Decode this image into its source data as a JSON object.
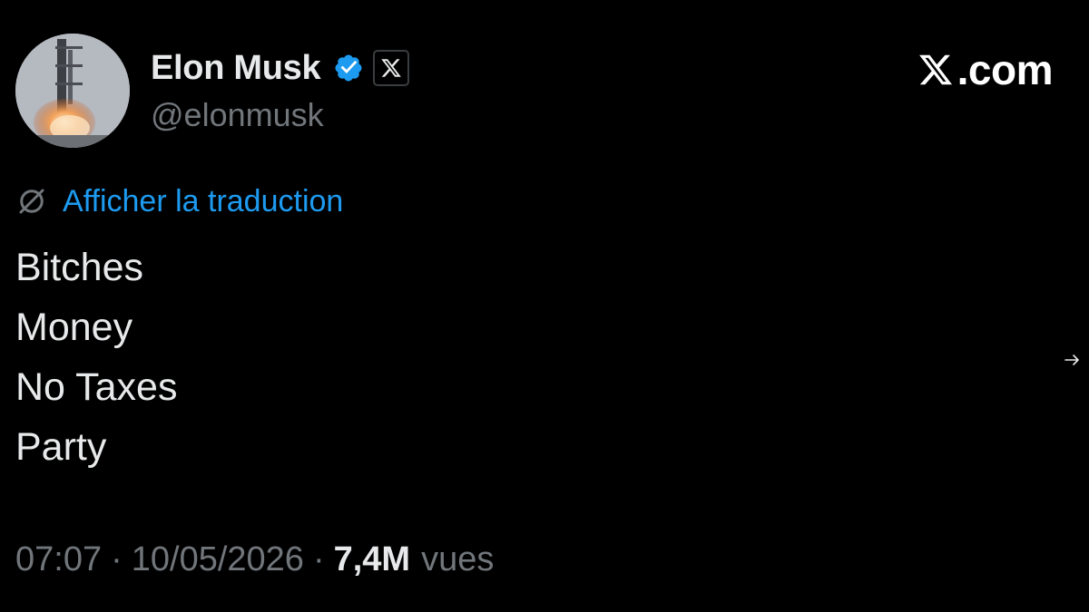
{
  "author": {
    "display_name": "Elon Musk",
    "handle": "@elonmusk",
    "avatar_icon": "rocket-launch-avatar",
    "verified_icon": "verified-badge-icon",
    "affiliation_icon": "x-logo-icon"
  },
  "brand": {
    "logo_icon": "x-logo-icon",
    "text": ".com"
  },
  "translate": {
    "icon": "globe-icon",
    "label": "Afficher la traduction"
  },
  "tweet": {
    "lines": [
      "Bitches",
      "Money",
      "No Taxes",
      "Party"
    ]
  },
  "meta": {
    "time": "07:07",
    "separator": "·",
    "date": "10/05/2026",
    "views_count": "7,4M",
    "views_label": "vues"
  },
  "colors": {
    "background": "#000000",
    "text_primary": "#e7e9ea",
    "text_secondary": "#71767b",
    "link": "#1d9bf0",
    "verified": "#1d9bf0"
  }
}
